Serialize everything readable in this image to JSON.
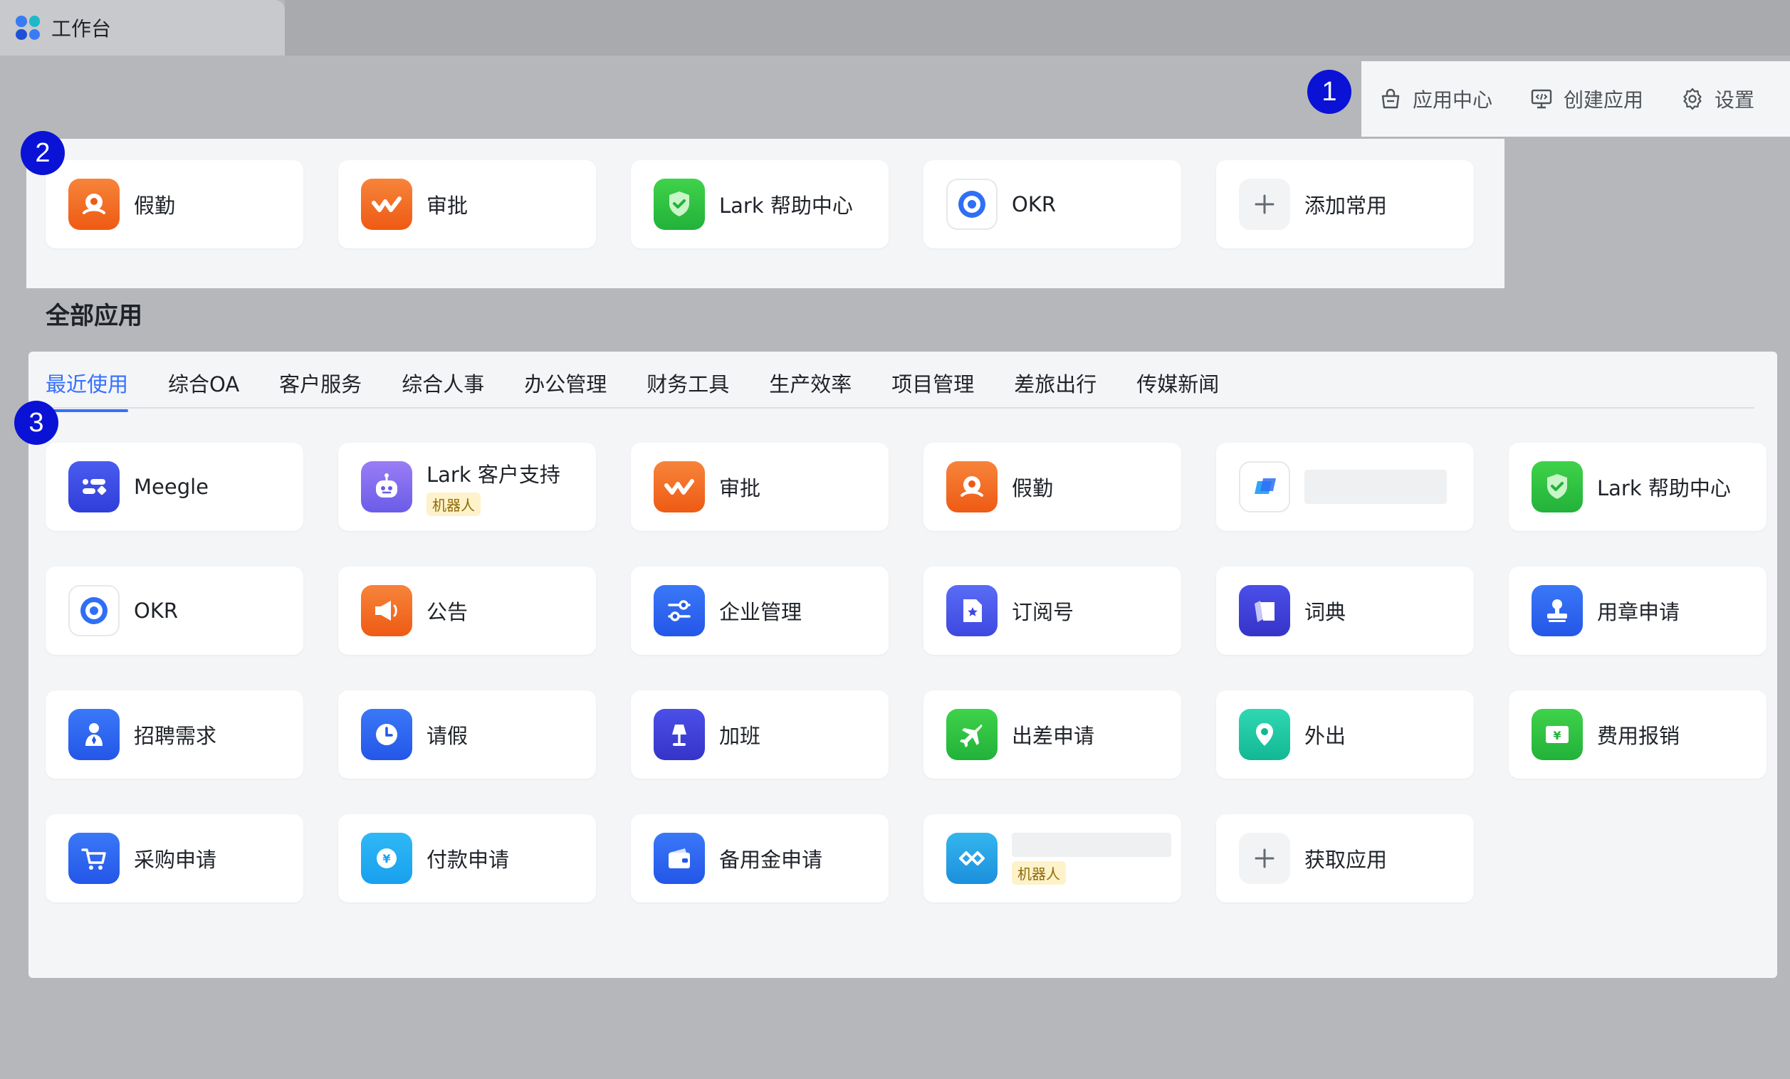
{
  "window": {
    "tab_title": "工作台"
  },
  "toolbar": {
    "app_center": "应用中心",
    "create_app": "创建应用",
    "settings": "设置"
  },
  "markers": [
    "1",
    "2",
    "3"
  ],
  "favorites": [
    {
      "label": "假勤",
      "icon": "attendance-icon"
    },
    {
      "label": "审批",
      "icon": "approval-icon"
    },
    {
      "label": "Lark 帮助中心",
      "icon": "help-center-icon"
    },
    {
      "label": "OKR",
      "icon": "okr-icon"
    },
    {
      "label": "添加常用",
      "icon": "plus-icon"
    }
  ],
  "all_apps": {
    "title": "全部应用",
    "tabs": [
      "最近使用",
      "综合OA",
      "客户服务",
      "综合人事",
      "办公管理",
      "财务工具",
      "生产效率",
      "项目管理",
      "差旅出行",
      "传媒新闻"
    ],
    "active_tab": "最近使用",
    "bot_badge": "机器人",
    "apps": [
      {
        "label": "Meegle",
        "icon": "meegle-icon"
      },
      {
        "label": "Lark 客户支持",
        "icon": "robot-icon",
        "badge": "机器人"
      },
      {
        "label": "审批",
        "icon": "approval-icon"
      },
      {
        "label": "假勤",
        "icon": "attendance-icon"
      },
      {
        "label": "",
        "icon": "redacted-app-icon"
      },
      {
        "label": "Lark 帮助中心",
        "icon": "help-center-icon"
      },
      {
        "label": "OKR",
        "icon": "okr-icon"
      },
      {
        "label": "公告",
        "icon": "megaphone-icon"
      },
      {
        "label": "企业管理",
        "icon": "sliders-icon"
      },
      {
        "label": "订阅号",
        "icon": "subscription-icon"
      },
      {
        "label": "词典",
        "icon": "dictionary-icon"
      },
      {
        "label": "用章申请",
        "icon": "stamp-icon"
      },
      {
        "label": "招聘需求",
        "icon": "recruit-icon"
      },
      {
        "label": "请假",
        "icon": "clock-icon"
      },
      {
        "label": "加班",
        "icon": "lamp-icon"
      },
      {
        "label": "出差申请",
        "icon": "airplane-icon"
      },
      {
        "label": "外出",
        "icon": "location-icon"
      },
      {
        "label": "费用报销",
        "icon": "expense-icon"
      },
      {
        "label": "采购申请",
        "icon": "cart-icon"
      },
      {
        "label": "付款申请",
        "icon": "payment-icon"
      },
      {
        "label": "备用金申请",
        "icon": "wallet-icon"
      },
      {
        "label": "",
        "icon": "bot-app-icon",
        "badge": "机器人"
      },
      {
        "label": "获取应用",
        "icon": "plus-icon"
      }
    ]
  },
  "colors": {
    "accent": "#3370ff",
    "marker": "#0a12d6",
    "orange": "#f5701d",
    "green": "#34c724",
    "blue": "#2e5cf6"
  }
}
